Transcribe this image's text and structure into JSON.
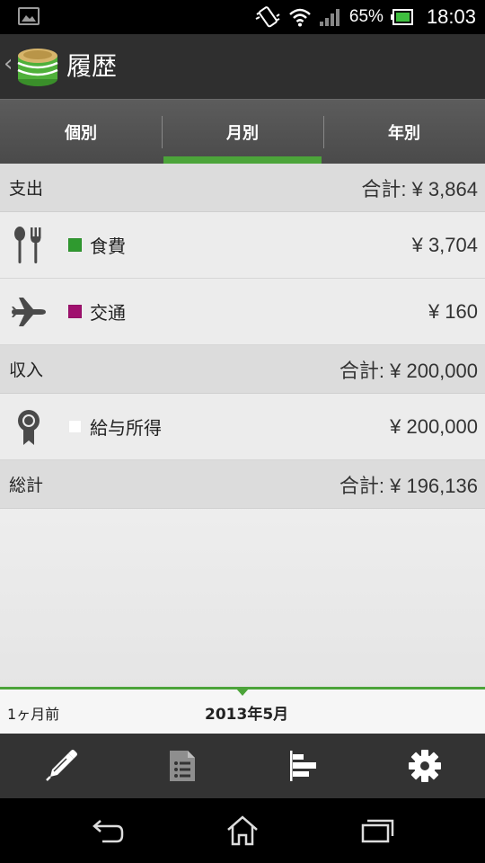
{
  "status_bar": {
    "battery_percent": "65%",
    "time": "18:03",
    "icons": [
      "gallery-icon",
      "vibrate-icon",
      "wifi-icon",
      "signal-icon",
      "battery-icon"
    ]
  },
  "action_bar": {
    "back_glyph": "‹",
    "title": "履歴",
    "logo_icon": "coin-stack-icon"
  },
  "tabs": [
    {
      "label": "個別",
      "active": false
    },
    {
      "label": "月別",
      "active": true
    },
    {
      "label": "年別",
      "active": false
    }
  ],
  "expense": {
    "title": "支出",
    "total": "合計: ¥ 3,864",
    "items": [
      {
        "icon": "fork-spoon-icon",
        "color": "#2f9a2f",
        "label": "食費",
        "amount": "¥ 3,704"
      },
      {
        "icon": "airplane-icon",
        "color": "#a0106e",
        "label": "交通",
        "amount": "¥ 160"
      }
    ]
  },
  "income": {
    "title": "収入",
    "total": "合計: ¥ 200,000",
    "items": [
      {
        "icon": "award-ribbon-icon",
        "color": "#ffffff",
        "label": "給与所得",
        "amount": "¥ 200,000"
      }
    ]
  },
  "grand_total": {
    "title": "総計",
    "total": "合計: ¥ 196,136"
  },
  "period": {
    "previous": "1ヶ月前",
    "current": "2013年5月"
  },
  "toolbar": {
    "items": [
      "pen-icon",
      "list-document-icon",
      "bar-chart-icon",
      "gear-icon"
    ]
  },
  "system_nav": {
    "items": [
      "back-icon",
      "home-icon",
      "recent-apps-icon"
    ]
  },
  "colors": {
    "accent": "#4ca43a",
    "food": "#2f9a2f",
    "transport": "#a0106e",
    "salary": "#ffffff"
  }
}
